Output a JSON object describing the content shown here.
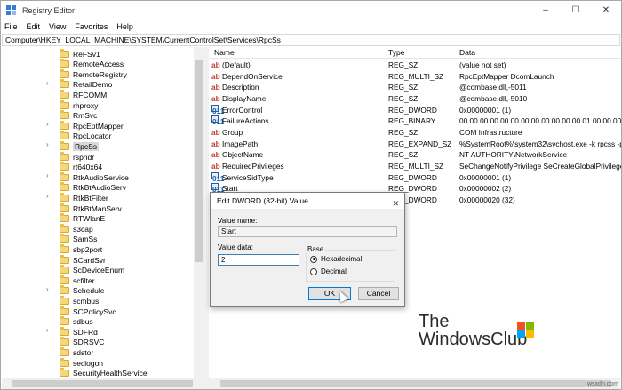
{
  "window": {
    "title": "Registry Editor",
    "minimize": "–",
    "maximize": "☐",
    "close": "✕"
  },
  "menu": [
    "File",
    "Edit",
    "View",
    "Favorites",
    "Help"
  ],
  "address": "Computer\\HKEY_LOCAL_MACHINE\\SYSTEM\\CurrentControlSet\\Services\\RpcSs",
  "tree": {
    "selected": "RpcSs",
    "items": [
      "ReFSv1",
      "RemoteAccess",
      "RemoteRegistry",
      "RetailDemo",
      "RFCOMM",
      "rhproxy",
      "RmSvc",
      "RpcEptMapper",
      "RpcLocator",
      "RpcSs",
      "rspndr",
      "rt640x64",
      "RtkAudioService",
      "RtkBtAudioServ",
      "RtkBtFilter",
      "RtkBtManServ",
      "RTWlanE",
      "s3cap",
      "SamSs",
      "sbp2port",
      "SCardSvr",
      "ScDeviceEnum",
      "scfilter",
      "Schedule",
      "scmbus",
      "SCPolicySvc",
      "sdbus",
      "SDFRd",
      "SDRSVC",
      "sdstor",
      "seclogon",
      "SecurityHealthService"
    ]
  },
  "list": {
    "headers": {
      "name": "Name",
      "type": "Type",
      "data": "Data"
    },
    "rows": [
      {
        "icon": "ab",
        "name": "(Default)",
        "type": "REG_SZ",
        "data": "(value not set)"
      },
      {
        "icon": "ab",
        "name": "DependOnService",
        "type": "REG_MULTI_SZ",
        "data": "RpcEptMapper DcomLaunch"
      },
      {
        "icon": "ab",
        "name": "Description",
        "type": "REG_SZ",
        "data": "@combase.dll,-5011"
      },
      {
        "icon": "ab",
        "name": "DisplayName",
        "type": "REG_SZ",
        "data": "@combase.dll,-5010"
      },
      {
        "icon": "bin",
        "name": "ErrorControl",
        "type": "REG_DWORD",
        "data": "0x00000001 (1)"
      },
      {
        "icon": "bin",
        "name": "FailureActions",
        "type": "REG_BINARY",
        "data": "00 00 00 00 00 00 00 00 00 00 00 00 01 00 00 00 00 00 00..."
      },
      {
        "icon": "ab",
        "name": "Group",
        "type": "REG_SZ",
        "data": "COM Infrastructure"
      },
      {
        "icon": "ab",
        "name": "ImagePath",
        "type": "REG_EXPAND_SZ",
        "data": "%SystemRoot%\\system32\\svchost.exe -k rpcss -p"
      },
      {
        "icon": "ab",
        "name": "ObjectName",
        "type": "REG_SZ",
        "data": "NT AUTHORITY\\NetworkService"
      },
      {
        "icon": "ab",
        "name": "RequiredPrivileges",
        "type": "REG_MULTI_SZ",
        "data": "SeChangeNotifyPrivilege SeCreateGlobalPrivilege ..."
      },
      {
        "icon": "bin",
        "name": "ServiceSidType",
        "type": "REG_DWORD",
        "data": "0x00000001 (1)"
      },
      {
        "icon": "bin",
        "name": "Start",
        "type": "REG_DWORD",
        "data": "0x00000002 (2)"
      },
      {
        "icon": "bin",
        "name": "",
        "type": "REG_DWORD",
        "data": "0x00000020 (32)"
      }
    ]
  },
  "dialog": {
    "title": "Edit DWORD (32-bit) Value",
    "close": "✕",
    "value_name_label": "Value name:",
    "value_name": "Start",
    "value_data_label": "Value data:",
    "value_data": "2",
    "base_label": "Base",
    "hex_label": "Hexadecimal",
    "dec_label": "Decimal",
    "base_selected": "Hexadecimal",
    "ok": "OK",
    "cancel": "Cancel"
  },
  "logo": {
    "line1": "The",
    "line2": "WindowsClub"
  },
  "watermark": "wsxdn.com",
  "colors": {
    "ms_red": "#f25022",
    "ms_green": "#7fba00",
    "ms_blue": "#00a4ef",
    "ms_yellow": "#ffb900"
  }
}
